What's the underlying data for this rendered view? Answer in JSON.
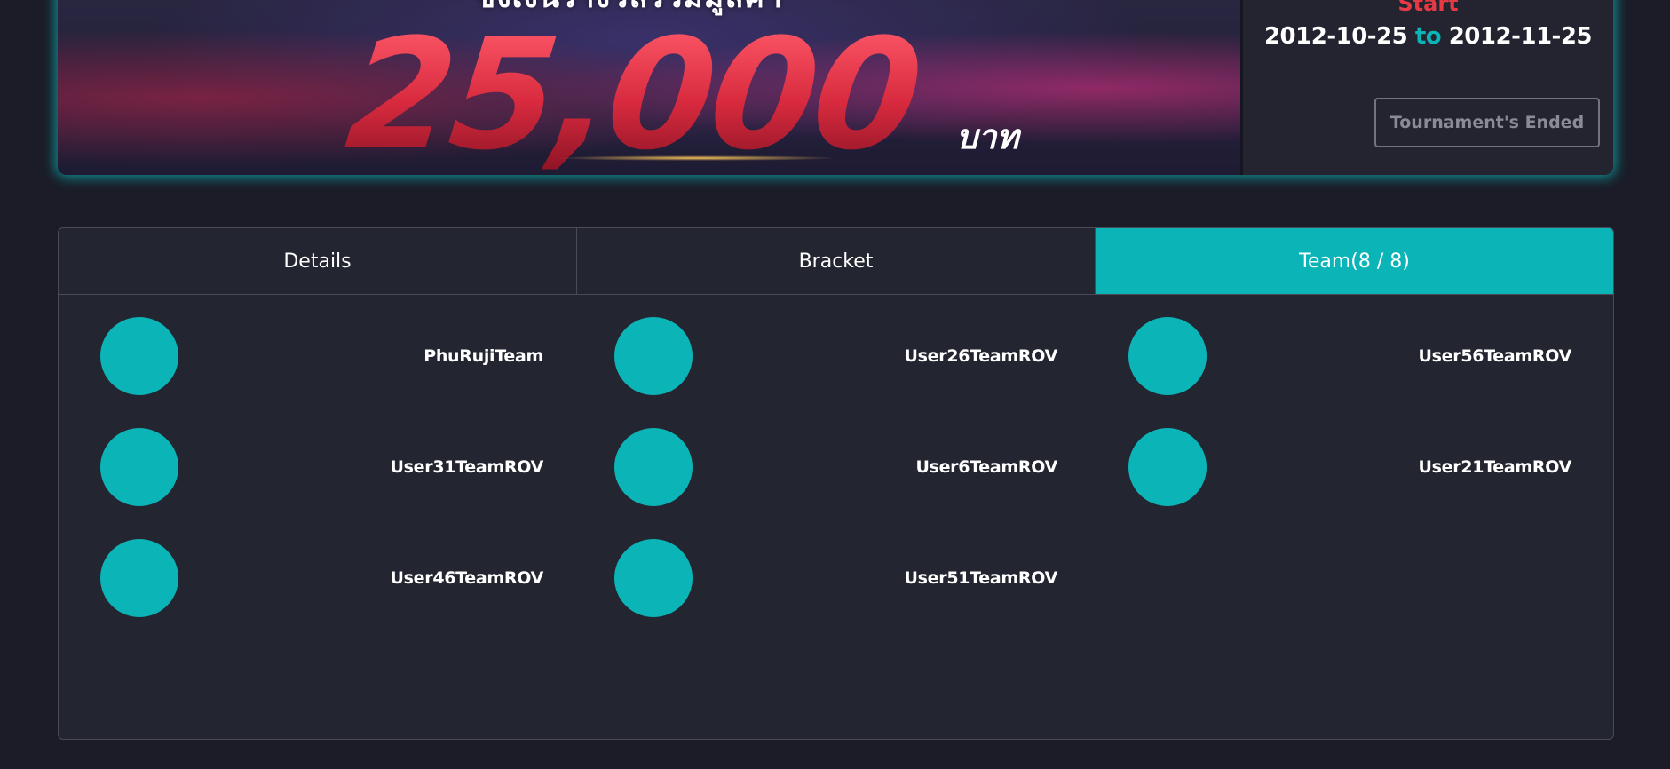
{
  "banner": {
    "subtitle": "ชิงเงินรางวัลรวมมูลค่า",
    "amount": "25,000",
    "unit": "บาท"
  },
  "info": {
    "start_label": "Start",
    "date_from": "2012-10-25",
    "date_to_word": "to",
    "date_to": "2012-11-25",
    "status_button": "Tournament's Ended"
  },
  "tabs": [
    {
      "label": "Details",
      "active": false
    },
    {
      "label": "Bracket",
      "active": false
    },
    {
      "label": "Team(8 / 8)",
      "active": true
    }
  ],
  "teams": [
    {
      "name": "PhuRujiTeam"
    },
    {
      "name": "User26TeamROV"
    },
    {
      "name": "User56TeamROV"
    },
    {
      "name": "User31TeamROV"
    },
    {
      "name": "User6TeamROV"
    },
    {
      "name": "User21TeamROV"
    },
    {
      "name": "User46TeamROV"
    },
    {
      "name": "User51TeamROV"
    }
  ],
  "colors": {
    "accent": "#0bb5b7",
    "start_label": "#e63946",
    "background": "#1b1c27",
    "panel": "#232530"
  }
}
